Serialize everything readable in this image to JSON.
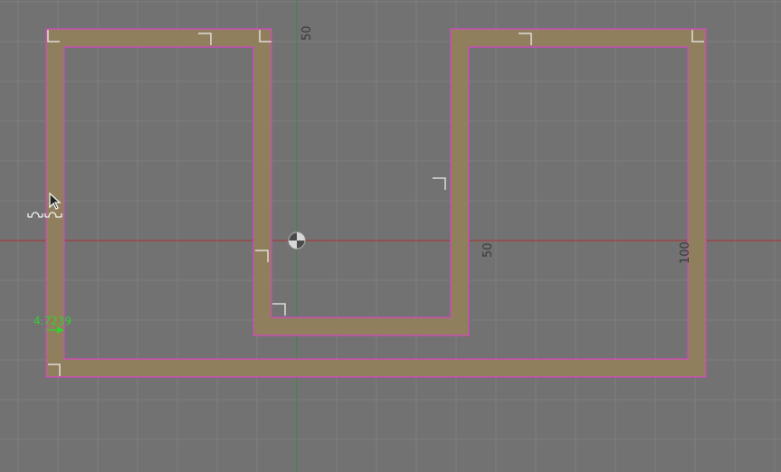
{
  "canvas": {
    "background_color": "#727272",
    "grid_color": "#7e7e7e",
    "x_axis_color": "#b03030",
    "y_axis_color": "#3a8a3a",
    "face_fill_color": "#907f5c",
    "edge_color": "#d645c6",
    "marker_color": "#eeeeee",
    "dimension_color": "#2fd12f"
  },
  "axis_labels": {
    "y_axis_50": "50",
    "x_axis_50": "50",
    "x_axis_100": "100"
  },
  "dimension": {
    "value": "4.7239"
  },
  "icons": {
    "origin": "origin-icon",
    "cursor": "constraint-cursor-icon"
  }
}
